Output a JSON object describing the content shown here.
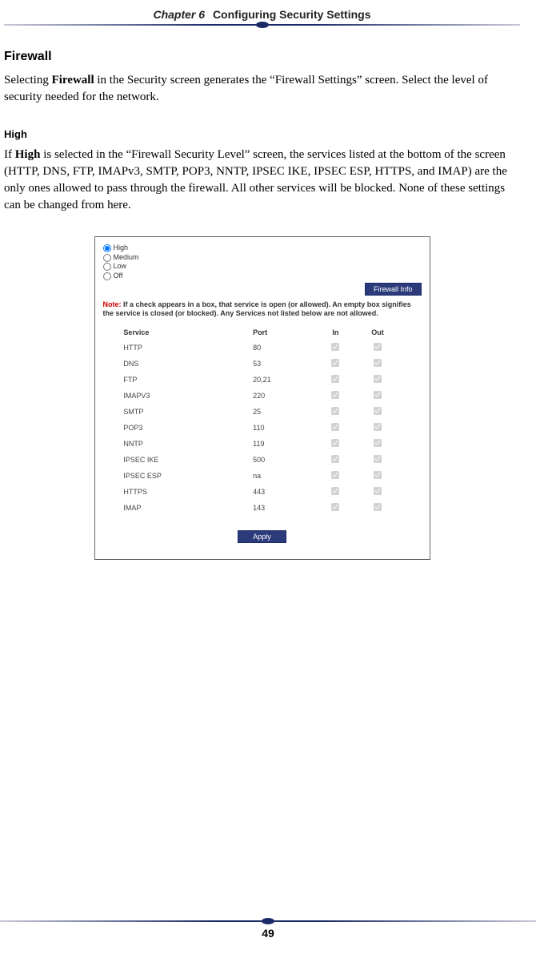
{
  "header": {
    "chapter": "Chapter 6",
    "title": "Configuring Security Settings"
  },
  "section1": {
    "heading": "Firewall",
    "p_pre": "Selecting ",
    "p_bold": "Firewall",
    "p_post": " in the Security screen generates the “Firewall Settings” screen. Select the level of security needed for the network."
  },
  "section2": {
    "heading": "High",
    "p_pre": "If ",
    "p_bold": "High",
    "p_mid1": " is selected in the “Firewall Security Level” screen, the services listed at the bottom of the screen (",
    "services_inline": "HTTP, DNS, FTP, IMAPv3, SMTP, POP3, NNTP, IPSEC IKE, IPSEC ESP, HTTPS,",
    "p_and": " and ",
    "services_inline2": "IMAP",
    "p_post": ") are the only ones allowed to pass through the firewall. All other services will be blocked. None of these settings can be changed from here."
  },
  "screenshot": {
    "radios": [
      "High",
      "Medium",
      "Low",
      "Off"
    ],
    "info_btn": "Firewall Info",
    "note_label": "Note:",
    "note_text": " If a check appears in a box, that service is open (or allowed). An empty box signifies the service is closed (or blocked). Any Services not listed below are not allowed.",
    "headers": {
      "service": "Service",
      "port": "Port",
      "in": "In",
      "out": "Out"
    },
    "rows": [
      {
        "svc": "HTTP",
        "port": "80",
        "in": true,
        "out": true
      },
      {
        "svc": "DNS",
        "port": "53",
        "in": true,
        "out": true
      },
      {
        "svc": "FTP",
        "port": "20,21",
        "in": true,
        "out": true
      },
      {
        "svc": "IMAPV3",
        "port": "220",
        "in": true,
        "out": true
      },
      {
        "svc": "SMTP",
        "port": "25",
        "in": true,
        "out": true
      },
      {
        "svc": "POP3",
        "port": "110",
        "in": true,
        "out": true
      },
      {
        "svc": "NNTP",
        "port": "119",
        "in": true,
        "out": true
      },
      {
        "svc": "IPSEC IKE",
        "port": "500",
        "in": true,
        "out": true
      },
      {
        "svc": "IPSEC ESP",
        "port": "na",
        "in": true,
        "out": true
      },
      {
        "svc": "HTTPS",
        "port": "443",
        "in": true,
        "out": true
      },
      {
        "svc": "IMAP",
        "port": "143",
        "in": true,
        "out": true
      }
    ],
    "apply_btn": "Apply"
  },
  "footer": {
    "page": "49"
  }
}
